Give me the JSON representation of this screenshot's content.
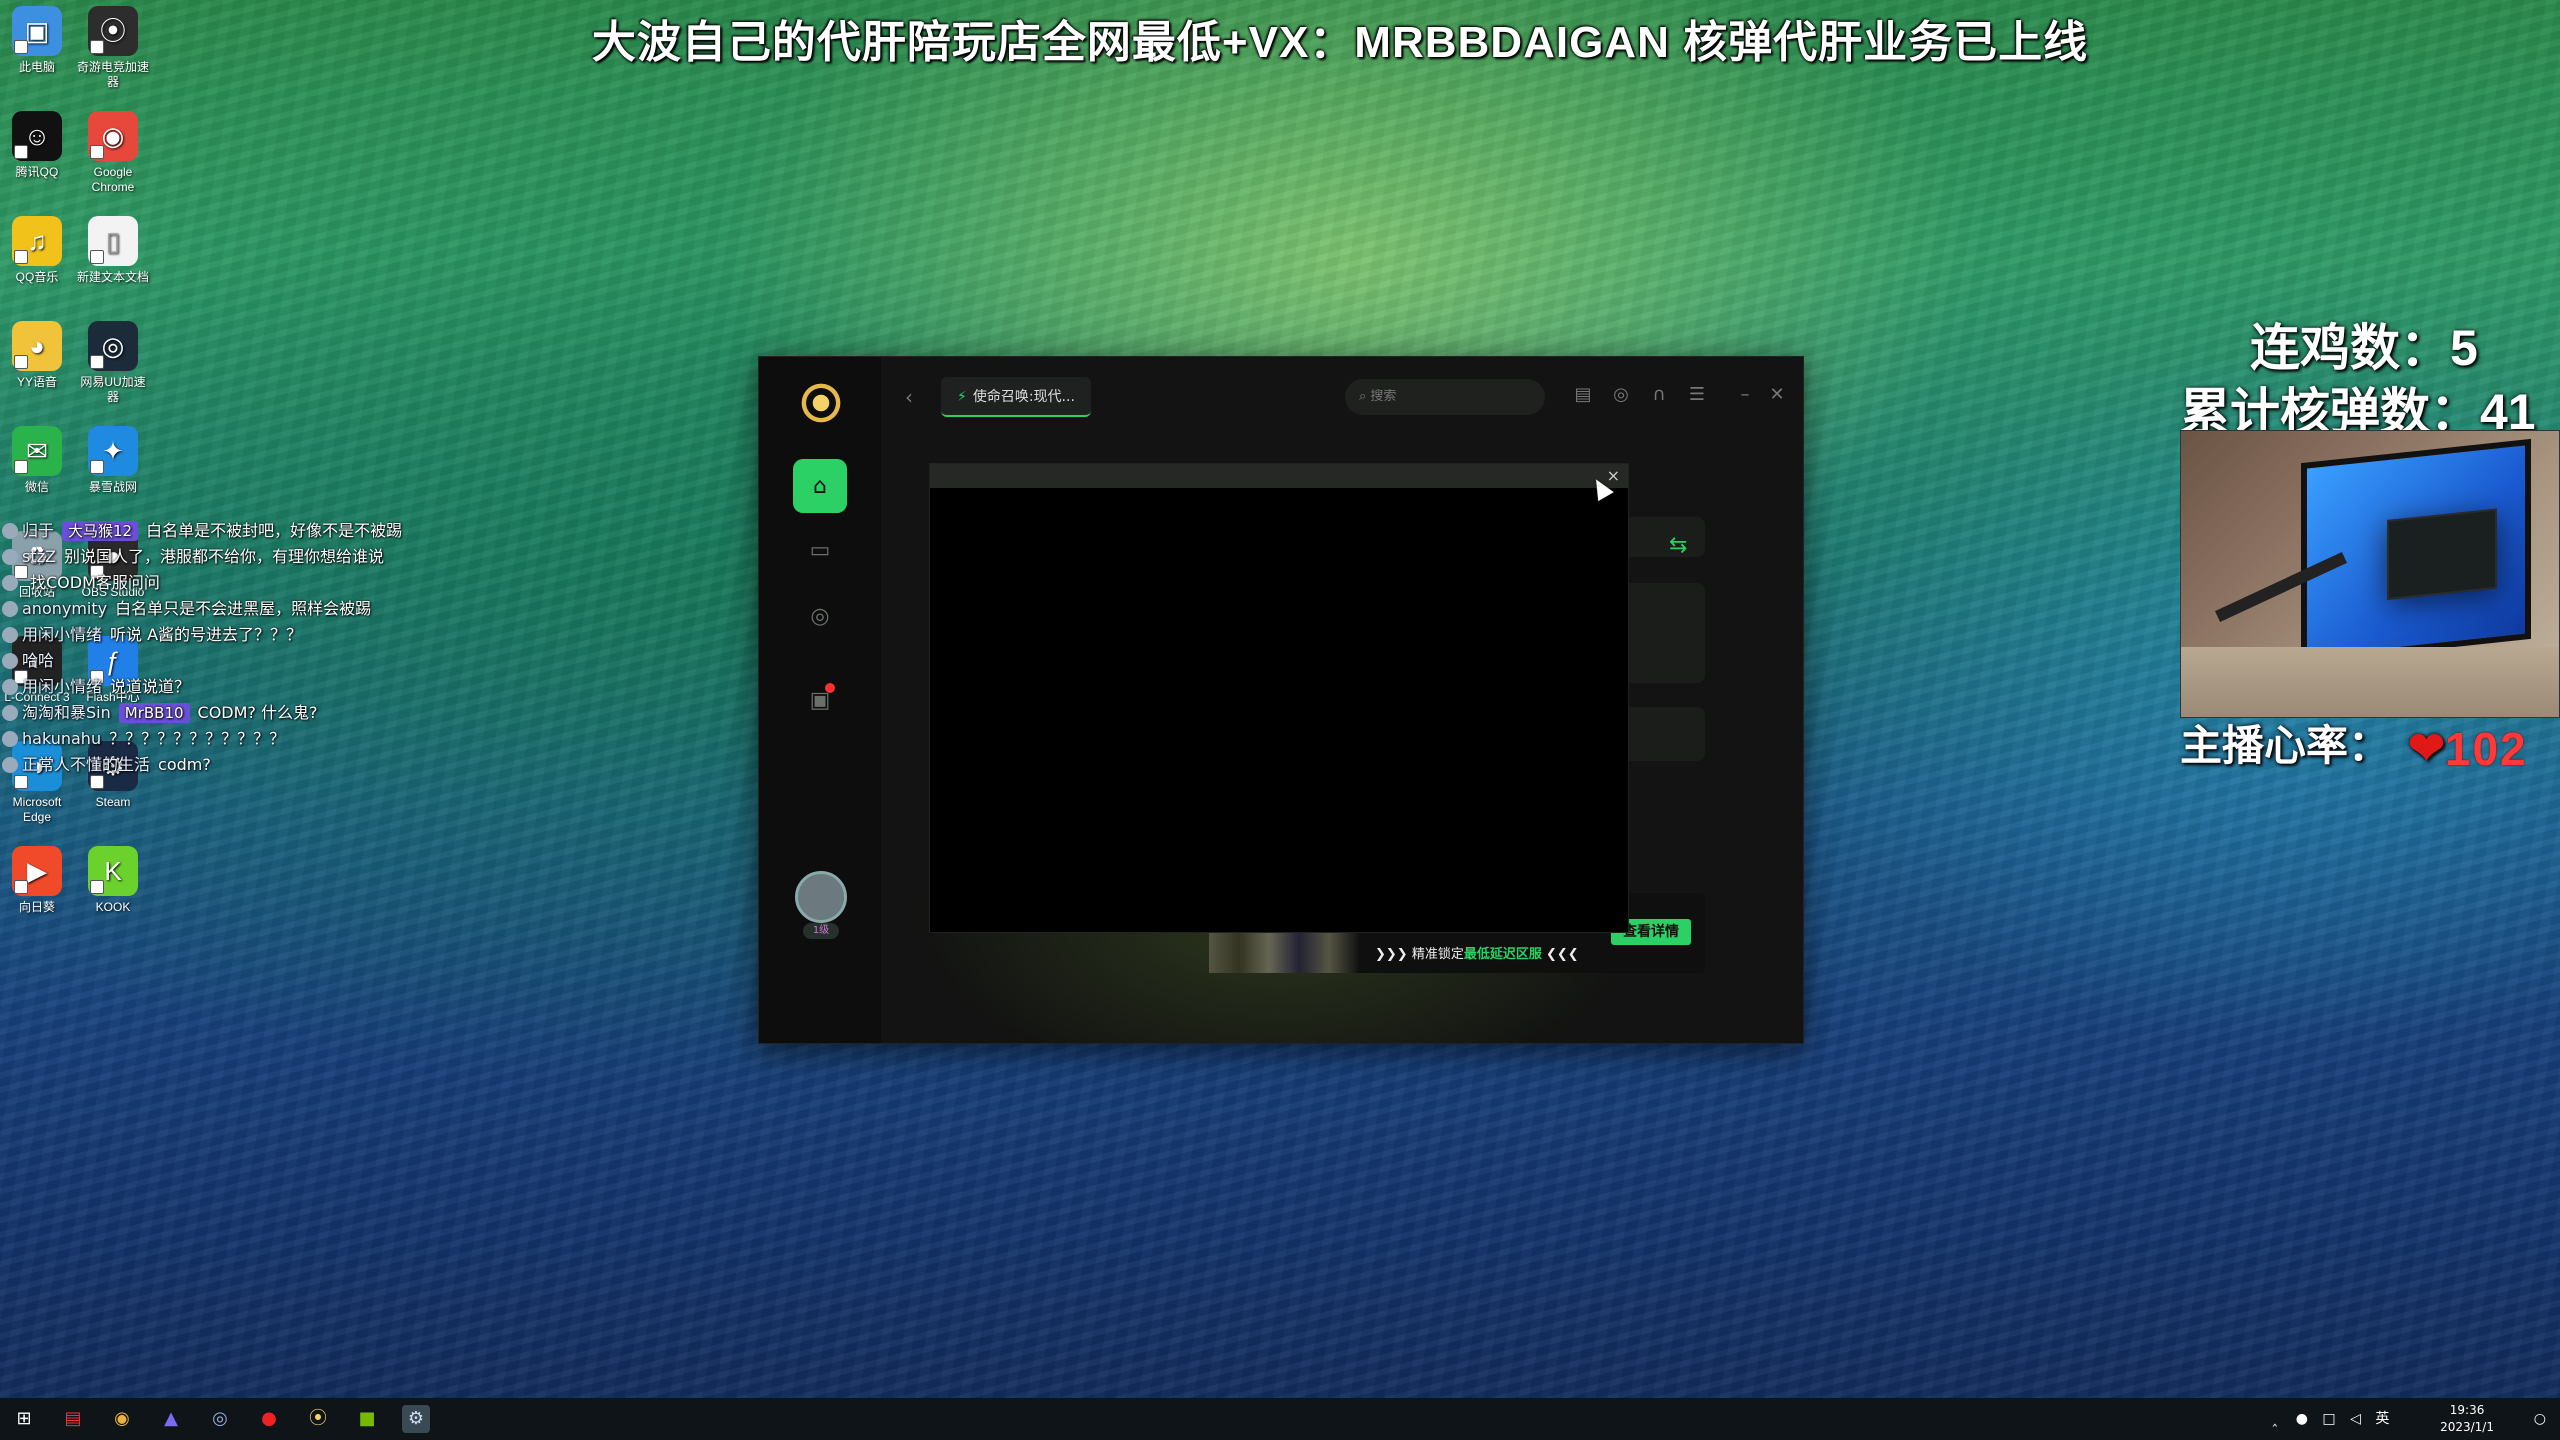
{
  "overlay": {
    "banner": "大波自己的代肝陪玩店全网最低+VX：MRBBDAIGAN  核弹代肝业务已上线",
    "chicken_label": "连鸡数：5",
    "nuke_label": "累计核弹数：41",
    "heart_label": "主播心率：",
    "heart_rate": "102"
  },
  "desktop_icons": [
    {
      "label": "此电脑",
      "icon": "computer-icon",
      "color": "#3d8fe0"
    },
    {
      "label": "奇游电竞加速器",
      "icon": "qiyou-icon",
      "color": "#2d2d2d"
    },
    {
      "label": "腾讯QQ",
      "icon": "qq-icon",
      "color": "#111"
    },
    {
      "label": "Google Chrome",
      "icon": "chrome-icon",
      "color": "#e8483b"
    },
    {
      "label": "QQ音乐",
      "icon": "qqmusic-icon",
      "color": "#f0c21a"
    },
    {
      "label": "新建文本文档",
      "icon": "text-file-icon",
      "color": "#f3f3f3"
    },
    {
      "label": "YY语音",
      "icon": "yy-icon",
      "color": "#f1c33a"
    },
    {
      "label": "网易UU加速器",
      "icon": "uu-icon",
      "color": "#1b2b3a"
    },
    {
      "label": "微信",
      "icon": "wechat-icon",
      "color": "#2ab34a"
    },
    {
      "label": "暴雪战网",
      "icon": "battlenet-icon",
      "color": "#1e8be0"
    },
    {
      "label": "回收站",
      "icon": "recycle-bin-icon",
      "color": "#8aa0aa"
    },
    {
      "label": "OBS Studio",
      "icon": "obs-icon",
      "color": "#2a2a2a"
    },
    {
      "label": "L-Connect 3",
      "icon": "lconnect-icon",
      "color": "#222"
    },
    {
      "label": "Flash中心",
      "icon": "flash-icon",
      "color": "#2080e8"
    },
    {
      "label": "Microsoft Edge",
      "icon": "edge-icon",
      "color": "#1a8fd8"
    },
    {
      "label": "Steam",
      "icon": "steam-icon",
      "color": "#1a2a44"
    },
    {
      "label": "向日葵",
      "icon": "sunflower-icon",
      "color": "#f04a2a"
    },
    {
      "label": "KOOK",
      "icon": "kook-icon",
      "color": "#6bd12c"
    }
  ],
  "chat": [
    {
      "user": "归于",
      "badge": "大马猴12",
      "text": "白名单是不被封吧，好像不是不被踢"
    },
    {
      "user": "stzZ",
      "badge": "",
      "text": "别说国人了，港服都不给你，有理你想给谁说"
    },
    {
      "user": "",
      "badge": "",
      "text": "找CODM客服问问"
    },
    {
      "user": "anonymity",
      "badge": "",
      "text": "白名单只是不会进黑屋，照样会被踢"
    },
    {
      "user": "用闲小情绪",
      "badge": "",
      "text": "听说 A酱的号进去了？？？"
    },
    {
      "user": "哈哈",
      "badge": "",
      "text": ""
    },
    {
      "user": "用闲小情绪",
      "badge": "",
      "text": "说道说道？"
    },
    {
      "user": "淘淘和暴Sin",
      "badge": "MrBB10",
      "text": "CODM? 什么鬼?"
    },
    {
      "user": "hakunahu",
      "badge": "",
      "text": "？？？？？？？？？？？"
    },
    {
      "user": "正常人不懂的生活",
      "badge": "",
      "text": "codm?"
    }
  ],
  "app": {
    "game_tab": "使命召唤:现代...",
    "search_placeholder": "搜索",
    "user_level": "1级",
    "promo_tagline_prefix": "精准锁定",
    "promo_tagline_highlight": "最低延迟区服",
    "promo_button": "查看详情",
    "popup_close": "×"
  },
  "taskbar": {
    "time": "19:36",
    "date": "2023/1/1",
    "ime": "英",
    "items": [
      "start-icon",
      "ad-icon",
      "chrome-icon",
      "obs-flame-icon",
      "uu-icon",
      "netease-music-icon",
      "qiyou-icon",
      "nvidia-icon",
      "steam-icon"
    ]
  }
}
